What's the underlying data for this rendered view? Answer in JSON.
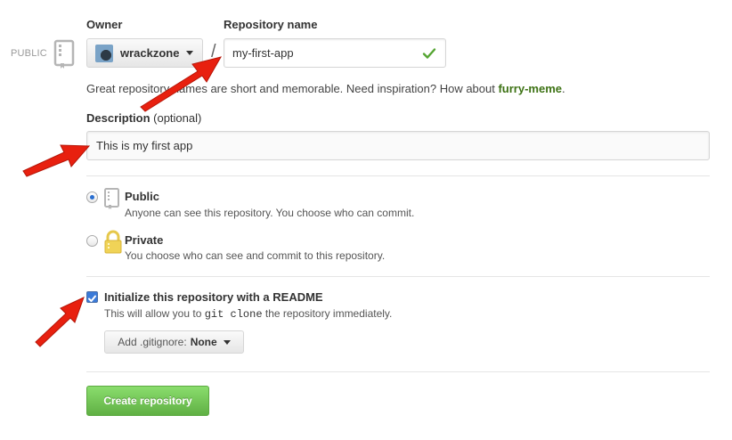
{
  "visibility_badge": "PUBLIC",
  "owner": {
    "label": "Owner",
    "name": "wrackzone"
  },
  "separator": "/",
  "repository": {
    "label": "Repository name",
    "value": "my-first-app"
  },
  "hint": {
    "text": "Great repository names are short and memorable. Need inspiration? How about ",
    "suggestion": "furry-meme",
    "end": "."
  },
  "description": {
    "label": "Description",
    "optional": "(optional)",
    "value": "This is my first app"
  },
  "visibility": {
    "public": {
      "title": "Public",
      "desc": "Anyone can see this repository. You choose who can commit.",
      "checked": true
    },
    "private": {
      "title": "Private",
      "desc": "You choose who can see and commit to this repository.",
      "checked": false
    }
  },
  "readme": {
    "label": "Initialize this repository with a README",
    "desc_before": "This will allow you to ",
    "desc_code": "git clone",
    "desc_after": " the repository immediately.",
    "checked": true
  },
  "gitignore": {
    "prefix": "Add .gitignore:",
    "value": "None"
  },
  "create_button": "Create repository",
  "colors": {
    "accent_green": "#60b044",
    "link_green": "#3d7214",
    "arrow_red": "#e8200f"
  }
}
